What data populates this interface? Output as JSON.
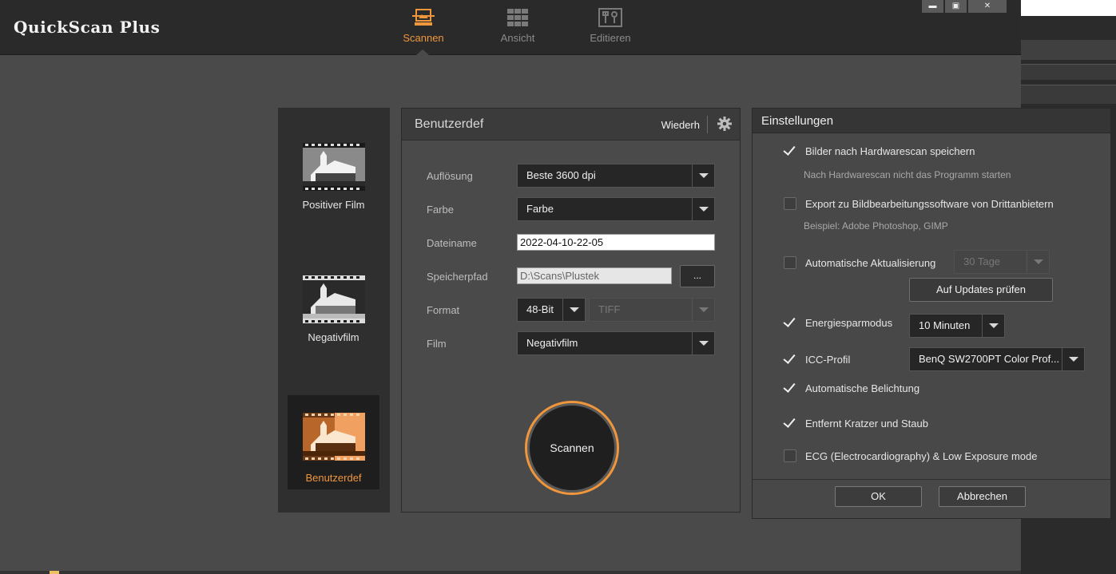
{
  "app": {
    "title": "QuickScan Plus"
  },
  "nav": {
    "items": [
      {
        "label": "Scannen",
        "icon": "scan-icon",
        "active": true
      },
      {
        "label": "Ansicht",
        "icon": "grid-view-icon",
        "active": false
      },
      {
        "label": "Editieren",
        "icon": "edit-tools-icon",
        "active": false
      }
    ]
  },
  "window_controls": {
    "minimize": "▬",
    "maximize": "▣",
    "close": "✕"
  },
  "film_types": [
    {
      "label": "Positiver Film",
      "selected": false
    },
    {
      "label": "Negativfilm",
      "selected": false
    },
    {
      "label": "Benutzerdef",
      "selected": true
    }
  ],
  "scan_panel": {
    "title": "Benutzerdef",
    "restore_label": "Wiederh",
    "resolution": {
      "label": "Auflösung",
      "value": "Beste 3600 dpi"
    },
    "color": {
      "label": "Farbe",
      "value": "Farbe"
    },
    "filename": {
      "label": "Dateiname",
      "value": "2022-04-10-22-05"
    },
    "save_path": {
      "label": "Speicherpfad",
      "value": "D:\\Scans\\Plustek",
      "browse": "..."
    },
    "format": {
      "label": "Format",
      "bit_depth": "48-Bit",
      "file_type": "TIFF"
    },
    "film": {
      "label": "Film",
      "value": "Negativfilm"
    },
    "scan_button": "Scannen"
  },
  "settings": {
    "title": "Einstellungen",
    "save_after_scan": {
      "label": "Bilder nach Hardwarescan speichern",
      "checked": true,
      "hint": "Nach Hardwarescan nicht das Programm starten"
    },
    "export_third_party": {
      "label": "Export zu Bildbearbeitungssoftware von Drittanbietern",
      "checked": false,
      "hint": "Beispiel: Adobe Photoshop, GIMP"
    },
    "auto_update": {
      "label": "Automatische Aktualisierung",
      "checked": false,
      "interval": "30 Tage",
      "check_button": "Auf Updates prüfen"
    },
    "power_saving": {
      "label": "Energiesparmodus",
      "checked": true,
      "value": "10 Minuten"
    },
    "icc_profile": {
      "label": "ICC-Profil",
      "checked": true,
      "value": "BenQ SW2700PT Color Prof..."
    },
    "auto_exposure": {
      "label": "Automatische Belichtung",
      "checked": true
    },
    "dust_removal": {
      "label": "Entfernt Kratzer und Staub",
      "checked": true
    },
    "ecg": {
      "label": "ECG (Electrocardiography) & Low Exposure mode",
      "checked": false
    },
    "ok": "OK",
    "cancel": "Abbrechen"
  },
  "colors": {
    "accent": "#f0963c",
    "background": "#4a4a4a",
    "titlebar": "#2a2a2a"
  }
}
